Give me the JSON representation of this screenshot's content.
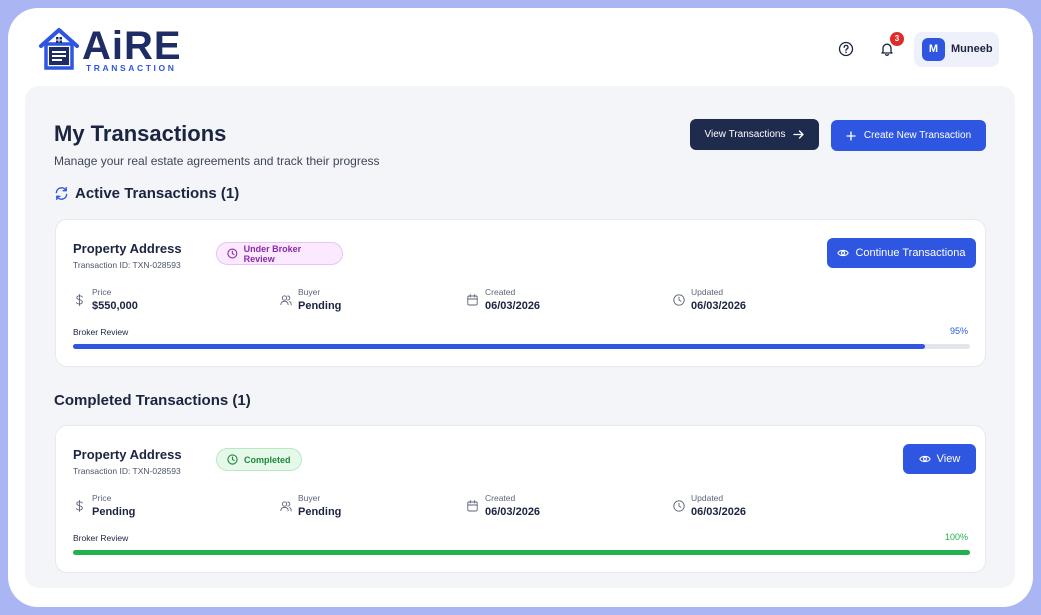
{
  "brand": {
    "name": "AiRE",
    "subtitle": "TRANSACTION",
    "primary_color": "#2f56e0",
    "dark_color": "#1e2d66"
  },
  "header": {
    "help_icon": "help-circle-icon",
    "bell_icon": "bell-icon",
    "notification_count": "3",
    "user": {
      "initial": "M",
      "name": "Muneeb"
    }
  },
  "page": {
    "title": "My Transactions",
    "subtitle": "Manage your real estate agreements and track their progress",
    "view_button": "View Transactions",
    "create_button": "Create New Transaction"
  },
  "active_section": {
    "title": "Active Transactions (1)",
    "transactions": [
      {
        "title": "Property Address",
        "id": "Transaction ID: TXN-028593",
        "status": "Under Broker Review",
        "action": "Continue Transactiona",
        "price_label": "Price",
        "price": "$550,000",
        "buyer_label": "Buyer",
        "buyer": "Pending",
        "created_label": "Created",
        "created": "06/03/2026",
        "updated_label": "Updated",
        "updated": "06/03/2026",
        "progress_label": "Broker Review",
        "progress_text": "95%",
        "progress": 0.95,
        "progress_color": "#2f56e0"
      }
    ]
  },
  "completed_section": {
    "title": "Completed Transactions (1)",
    "transactions": [
      {
        "title": "Property Address",
        "id": "Transaction ID: TXN-028593",
        "status": "Completed",
        "action": "View",
        "price_label": "Price",
        "price": "Pending",
        "buyer_label": "Buyer",
        "buyer": "Pending",
        "created_label": "Created",
        "created": "06/03/2026",
        "updated_label": "Updated",
        "updated": "06/03/2026",
        "progress_label": "Broker Review",
        "progress_text": "100%",
        "progress": 1.0,
        "progress_color": "#22b14c"
      }
    ]
  }
}
